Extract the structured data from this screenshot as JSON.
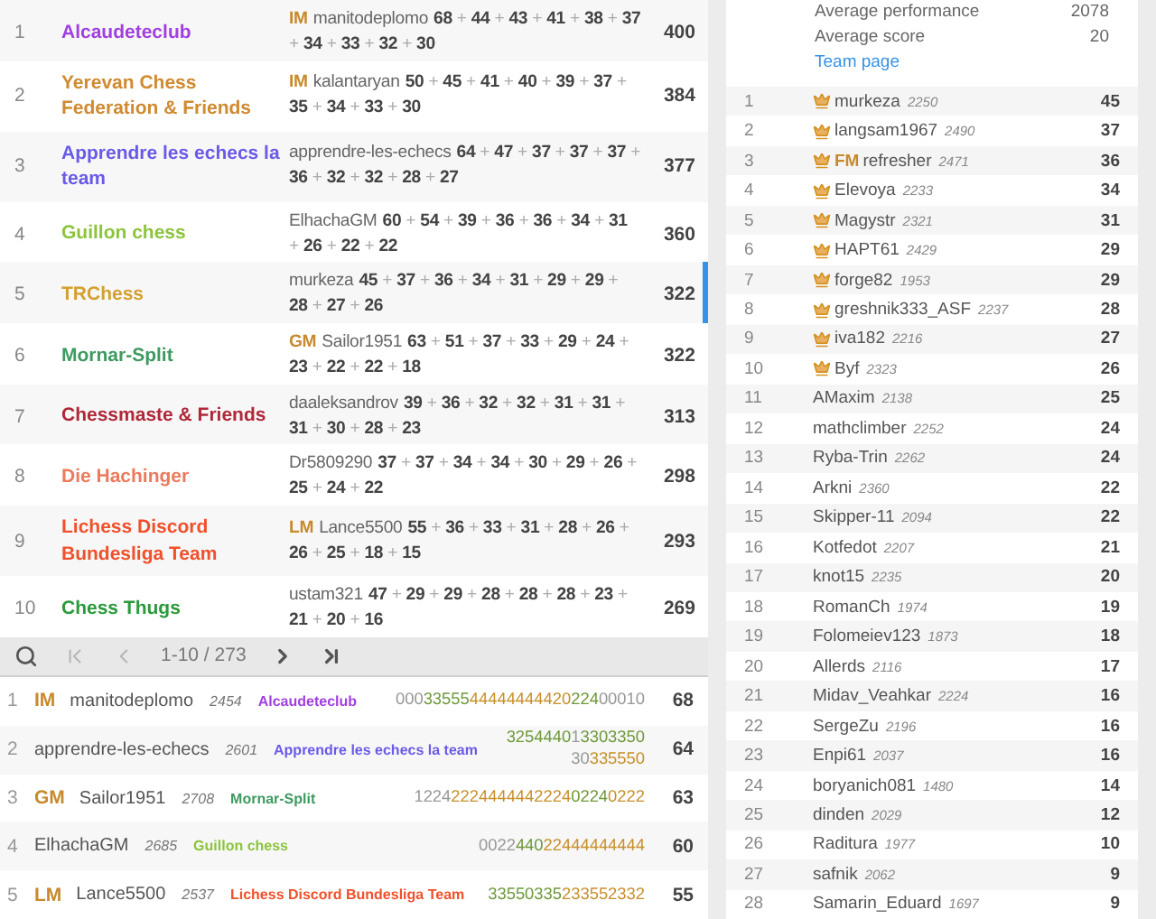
{
  "teams": [
    {
      "rank": "1",
      "name": "Alcaudeteclub",
      "color": "#a040e0",
      "title": "IM",
      "player": "manitodeplomo",
      "scores": "**68** + **44** + **43** + **41** + **38** + **37** + **34** + **33** + **32** + **30**",
      "total": "400",
      "selected": false
    },
    {
      "rank": "2",
      "name": "Yerevan Chess Federation & Friends",
      "color": "#d08a30",
      "title": "IM",
      "player": "kalantaryan",
      "scores": "**50** + **45** + **41** + **40** + **39** + **37** + **35** + **34** + **33** + **30**",
      "total": "384",
      "selected": false
    },
    {
      "rank": "3",
      "name": "Apprendre les echecs la team",
      "color": "#6a5ae8",
      "player": "apprendre-les-echecs",
      "scores": "**64** + **47** + **37** + **37** + **37** + **36** + **32** + **32** + **28** + **27**",
      "total": "377",
      "selected": false
    },
    {
      "rank": "4",
      "name": "Guillon chess",
      "color": "#8cc43c",
      "player": "ElhachaGM",
      "scores": "**60** + **54** + **39** + **36** + **36** + **34** + **31** + **26** + **22** + **22**",
      "total": "360",
      "selected": false
    },
    {
      "rank": "5",
      "name": "TRChess",
      "color": "#d4a030",
      "player": "murkeza",
      "scores": "**45** + **37** + **36** + **34** + **31** + **29** + **29** + **28** + **27** + **26**",
      "total": "322",
      "selected": true
    },
    {
      "rank": "6",
      "name": "Mornar-Split",
      "color": "#3e9a60",
      "title": "GM",
      "player": "Sailor1951",
      "scores": "**63** + **51** + **37** + **33** + **29** + **24** + **23** + **22** + **22** + **18**",
      "total": "322",
      "selected": false
    },
    {
      "rank": "7",
      "name": "Chessmaste & Friends",
      "color": "#b02838",
      "player": "daaleksandrov",
      "scores": "**39** + **36** + **32** + **32** + **31** + **31** + **31** + **30** + **28** + **23**",
      "total": "313",
      "selected": false
    },
    {
      "rank": "8",
      "name": "Die Hachinger",
      "color": "#ec7a5c",
      "player": "Dr5809290",
      "scores": "**37** + **37** + **34** + **34** + **30** + **29** + **26** + **25** + **24** + **22**",
      "total": "298",
      "selected": false
    },
    {
      "rank": "9",
      "name": "Lichess Discord Bundesliga Team",
      "color": "#f0502a",
      "title": "LM",
      "player": "Lance5500",
      "scores": "**55** + **36** + **33** + **31** + **28** + **26** + **26** + **25** + **18** + **15**",
      "total": "293",
      "selected": false
    },
    {
      "rank": "10",
      "name": "Chess Thugs",
      "color": "#2a9a3a",
      "player": "ustam321",
      "scores": "**47** + **29** + **29** + **28** + **28** + **28** + **23** + **21** + **20** + **16**",
      "total": "269",
      "selected": false
    }
  ],
  "pager": {
    "range": "1-10 / 273",
    "first_disabled": true,
    "prev_disabled": true
  },
  "players": [
    {
      "rank": "1",
      "title": "IM",
      "name": "manitodeplomo",
      "rating": "2454",
      "team": "Alcaudeteclub",
      "color": "#a040e0",
      "sheet": [
        {
          "digits": "000",
          "kind": "plain"
        },
        {
          "digits": "33555",
          "kind": "streak"
        },
        {
          "digits": "44444444420",
          "kind": "fire"
        },
        {
          "digits": "224",
          "kind": "streak"
        },
        {
          "digits": "00010",
          "kind": "plain"
        }
      ],
      "score": "68"
    },
    {
      "rank": "2",
      "name": "apprendre-les-echecs",
      "rating": "2601",
      "team": "Apprendre les echecs la team",
      "color": "#6a5ae8",
      "sheet": [
        {
          "digits": "3254440",
          "kind": "streak"
        },
        {
          "digits": "1",
          "kind": "plain"
        },
        {
          "digits": "3303350",
          "kind": "streak"
        },
        {
          "digits": "30",
          "kind": "plain"
        },
        {
          "digits": "335550",
          "kind": "fire"
        }
      ],
      "score": "64"
    },
    {
      "rank": "3",
      "title": "GM",
      "name": "Sailor1951",
      "rating": "2708",
      "team": "Mornar-Split",
      "color": "#3e9a60",
      "sheet": [
        {
          "digits": "1224",
          "kind": "plain"
        },
        {
          "digits": "2224444442224",
          "kind": "fire"
        },
        {
          "digits": "0224",
          "kind": "streak"
        },
        {
          "digits": "0222",
          "kind": "fire"
        }
      ],
      "score": "63"
    },
    {
      "rank": "4",
      "name": "ElhachaGM",
      "rating": "2685",
      "team": "Guillon chess",
      "color": "#8cc43c",
      "sheet": [
        {
          "digits": "0022",
          "kind": "plain"
        },
        {
          "digits": "440",
          "kind": "streak"
        },
        {
          "digits": "22444444444",
          "kind": "fire"
        }
      ],
      "score": "60"
    },
    {
      "rank": "5",
      "title": "LM",
      "name": "Lance5500",
      "rating": "2537",
      "team": "Lichess Discord Bundesliga Team",
      "color": "#f0502a",
      "sheet": [
        {
          "digits": "33550335",
          "kind": "streak"
        },
        {
          "digits": "233552332",
          "kind": "fire"
        }
      ],
      "score": "55"
    }
  ],
  "team_info": {
    "stats": [
      {
        "label": "Average performance",
        "value": "2078"
      },
      {
        "label": "Average score",
        "value": "20"
      }
    ],
    "link": "Team page"
  },
  "members": [
    {
      "rank": "1",
      "leader": true,
      "name": "murkeza",
      "rating": "2250",
      "score": "45"
    },
    {
      "rank": "2",
      "leader": true,
      "name": "langsam1967",
      "rating": "2490",
      "score": "37"
    },
    {
      "rank": "3",
      "leader": true,
      "title": "FM",
      "name": "refresher",
      "rating": "2471",
      "score": "36"
    },
    {
      "rank": "4",
      "leader": true,
      "name": "Elevoya",
      "rating": "2233",
      "score": "34"
    },
    {
      "rank": "5",
      "leader": true,
      "name": "Magystr",
      "rating": "2321",
      "score": "31"
    },
    {
      "rank": "6",
      "leader": true,
      "name": "HAPT61",
      "rating": "2429",
      "score": "29"
    },
    {
      "rank": "7",
      "leader": true,
      "name": "forge82",
      "rating": "1953",
      "score": "29"
    },
    {
      "rank": "8",
      "leader": true,
      "name": "greshnik333_ASF",
      "rating": "2237",
      "score": "28"
    },
    {
      "rank": "9",
      "leader": true,
      "name": "iva182",
      "rating": "2216",
      "score": "27"
    },
    {
      "rank": "10",
      "leader": true,
      "name": "Byf",
      "rating": "2323",
      "score": "26"
    },
    {
      "rank": "11",
      "leader": false,
      "name": "AMaxim",
      "rating": "2138",
      "score": "25"
    },
    {
      "rank": "12",
      "leader": false,
      "name": "mathclimber",
      "rating": "2252",
      "score": "24"
    },
    {
      "rank": "13",
      "leader": false,
      "name": "Ryba-Trin",
      "rating": "2262",
      "score": "24"
    },
    {
      "rank": "14",
      "leader": false,
      "name": "Arkni",
      "rating": "2360",
      "score": "22"
    },
    {
      "rank": "15",
      "leader": false,
      "name": "Skipper-11",
      "rating": "2094",
      "score": "22"
    },
    {
      "rank": "16",
      "leader": false,
      "name": "Kotfedot",
      "rating": "2207",
      "score": "21"
    },
    {
      "rank": "17",
      "leader": false,
      "name": "knot15",
      "rating": "2235",
      "score": "20"
    },
    {
      "rank": "18",
      "leader": false,
      "name": "RomanCh",
      "rating": "1974",
      "score": "19"
    },
    {
      "rank": "19",
      "leader": false,
      "name": "Folomeiev123",
      "rating": "1873",
      "score": "18"
    },
    {
      "rank": "20",
      "leader": false,
      "name": "Allerds",
      "rating": "2116",
      "score": "17"
    },
    {
      "rank": "21",
      "leader": false,
      "name": "Midav_Veahkar",
      "rating": "2224",
      "score": "16"
    },
    {
      "rank": "22",
      "leader": false,
      "name": "SergeZu",
      "rating": "2196",
      "score": "16"
    },
    {
      "rank": "23",
      "leader": false,
      "name": "Enpi61",
      "rating": "2037",
      "score": "16"
    },
    {
      "rank": "24",
      "leader": false,
      "name": "boryanich081",
      "rating": "1480",
      "score": "14"
    },
    {
      "rank": "25",
      "leader": false,
      "name": "dinden",
      "rating": "2029",
      "score": "12"
    },
    {
      "rank": "26",
      "leader": false,
      "name": "Raditura",
      "rating": "1977",
      "score": "10"
    },
    {
      "rank": "27",
      "leader": false,
      "name": "safnik",
      "rating": "2062",
      "score": "9"
    },
    {
      "rank": "28",
      "leader": false,
      "name": "Samarin_Eduard",
      "rating": "1697",
      "score": "9"
    }
  ]
}
